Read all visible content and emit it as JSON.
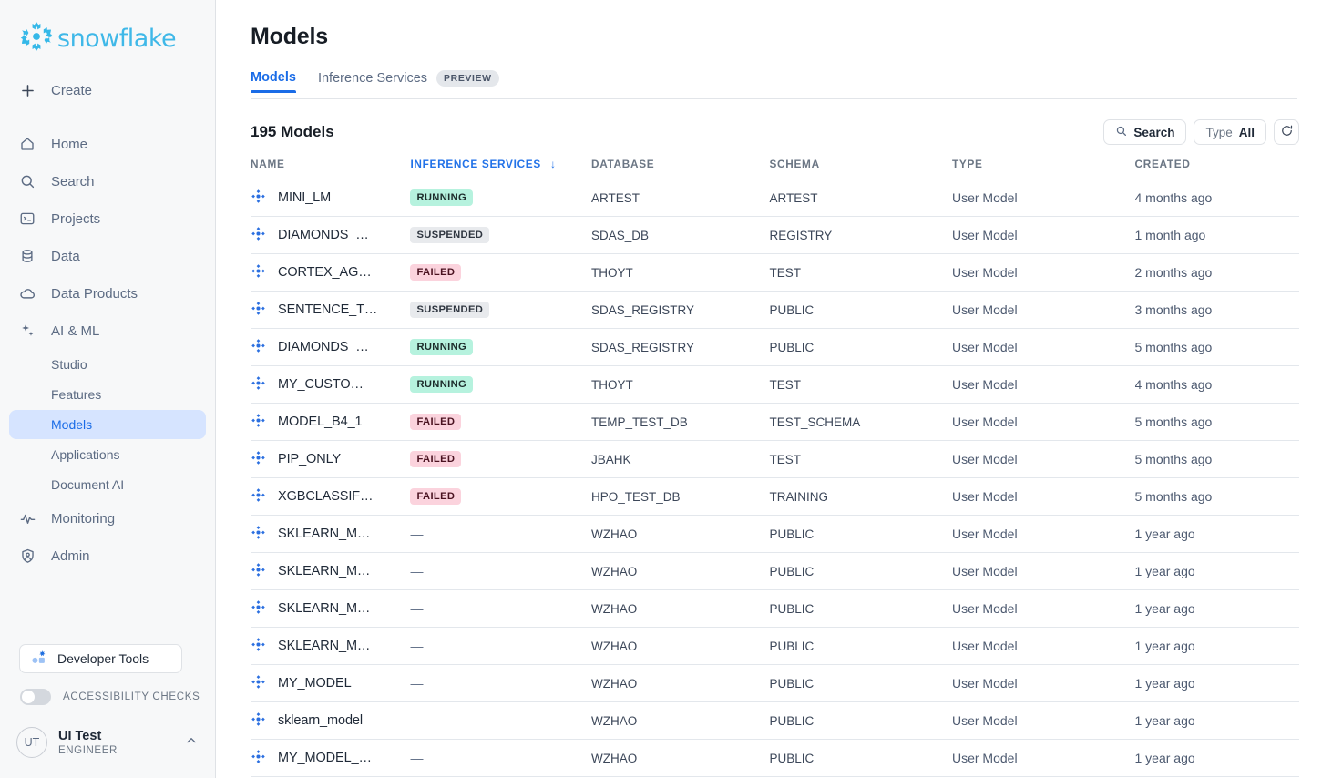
{
  "brand": {
    "name": "snowflake",
    "logo_color": "#35b8e8"
  },
  "sidebar": {
    "create_label": "Create",
    "items": [
      {
        "label": "Home",
        "icon": "home-icon"
      },
      {
        "label": "Search",
        "icon": "search-icon"
      },
      {
        "label": "Projects",
        "icon": "projects-icon"
      },
      {
        "label": "Data",
        "icon": "database-icon"
      },
      {
        "label": "Data Products",
        "icon": "cloud-icon"
      },
      {
        "label": "AI & ML",
        "icon": "sparkle-icon"
      }
    ],
    "sub_items": [
      {
        "label": "Studio",
        "active": false
      },
      {
        "label": "Features",
        "active": false
      },
      {
        "label": "Models",
        "active": true
      },
      {
        "label": "Applications",
        "active": false
      },
      {
        "label": "Document AI",
        "active": false
      }
    ],
    "items_after": [
      {
        "label": "Monitoring",
        "icon": "activity-icon"
      },
      {
        "label": "Admin",
        "icon": "shield-person-icon"
      }
    ],
    "developer_tools_label": "Developer Tools",
    "accessibility_label": "ACCESSIBILITY CHECKS",
    "accessibility_on": false,
    "user": {
      "initials": "UT",
      "name": "UI Test",
      "role": "ENGINEER"
    }
  },
  "header": {
    "title": "Models",
    "tabs": [
      {
        "label": "Models",
        "active": true,
        "badge": ""
      },
      {
        "label": "Inference Services",
        "active": false,
        "badge": "PREVIEW"
      }
    ]
  },
  "toolbar": {
    "count_label": "195 Models",
    "search_label": "Search",
    "type_filter_label": "Type",
    "type_filter_value": "All",
    "refresh_label": "Refresh"
  },
  "table": {
    "columns": [
      {
        "key": "name",
        "label": "NAME",
        "sorted": false
      },
      {
        "key": "inference",
        "label": "INFERENCE SERVICES",
        "sorted": true,
        "sort_dir": "desc"
      },
      {
        "key": "database",
        "label": "DATABASE",
        "sorted": false
      },
      {
        "key": "schema",
        "label": "SCHEMA",
        "sorted": false
      },
      {
        "key": "type",
        "label": "TYPE",
        "sorted": false
      },
      {
        "key": "created",
        "label": "CREATED",
        "sorted": false
      }
    ],
    "rows": [
      {
        "name": "MINI_LM",
        "status": "RUNNING",
        "database": "ARTEST",
        "schema": "ARTEST",
        "type": "User Model",
        "created": "4 months ago"
      },
      {
        "name": "DIAMONDS_…",
        "status": "SUSPENDED",
        "database": "SDAS_DB",
        "schema": "REGISTRY",
        "type": "User Model",
        "created": "1 month ago"
      },
      {
        "name": "CORTEX_AG…",
        "status": "FAILED",
        "database": "THOYT",
        "schema": "TEST",
        "type": "User Model",
        "created": "2 months ago"
      },
      {
        "name": "SENTENCE_T…",
        "status": "SUSPENDED",
        "database": "SDAS_REGISTRY",
        "schema": "PUBLIC",
        "type": "User Model",
        "created": "3 months ago"
      },
      {
        "name": "DIAMONDS_…",
        "status": "RUNNING",
        "database": "SDAS_REGISTRY",
        "schema": "PUBLIC",
        "type": "User Model",
        "created": "5 months ago"
      },
      {
        "name": "MY_CUSTO…",
        "status": "RUNNING",
        "database": "THOYT",
        "schema": "TEST",
        "type": "User Model",
        "created": "4 months ago"
      },
      {
        "name": "MODEL_B4_1",
        "status": "FAILED",
        "database": "TEMP_TEST_DB",
        "schema": "TEST_SCHEMA",
        "type": "User Model",
        "created": "5 months ago"
      },
      {
        "name": "PIP_ONLY",
        "status": "FAILED",
        "database": "JBAHK",
        "schema": "TEST",
        "type": "User Model",
        "created": "5 months ago"
      },
      {
        "name": "XGBCLASSIF…",
        "status": "FAILED",
        "database": "HPO_TEST_DB",
        "schema": "TRAINING",
        "type": "User Model",
        "created": "5 months ago"
      },
      {
        "name": "SKLEARN_M…",
        "status": "—",
        "database": "WZHAO",
        "schema": "PUBLIC",
        "type": "User Model",
        "created": "1 year ago"
      },
      {
        "name": "SKLEARN_M…",
        "status": "—",
        "database": "WZHAO",
        "schema": "PUBLIC",
        "type": "User Model",
        "created": "1 year ago"
      },
      {
        "name": "SKLEARN_M…",
        "status": "—",
        "database": "WZHAO",
        "schema": "PUBLIC",
        "type": "User Model",
        "created": "1 year ago"
      },
      {
        "name": "SKLEARN_M…",
        "status": "—",
        "database": "WZHAO",
        "schema": "PUBLIC",
        "type": "User Model",
        "created": "1 year ago"
      },
      {
        "name": "MY_MODEL",
        "status": "—",
        "database": "WZHAO",
        "schema": "PUBLIC",
        "type": "User Model",
        "created": "1 year ago"
      },
      {
        "name": "sklearn_model",
        "status": "—",
        "database": "WZHAO",
        "schema": "PUBLIC",
        "type": "User Model",
        "created": "1 year ago"
      },
      {
        "name": "MY_MODEL_…",
        "status": "—",
        "database": "WZHAO",
        "schema": "PUBLIC",
        "type": "User Model",
        "created": "1 year ago"
      }
    ]
  },
  "colors": {
    "accent": "#1a6ce7",
    "running_bg": "#b6f2de",
    "suspended_bg": "#e8eaed",
    "failed_bg": "#fbd3dd",
    "model_icon": "#2b6fe0"
  }
}
